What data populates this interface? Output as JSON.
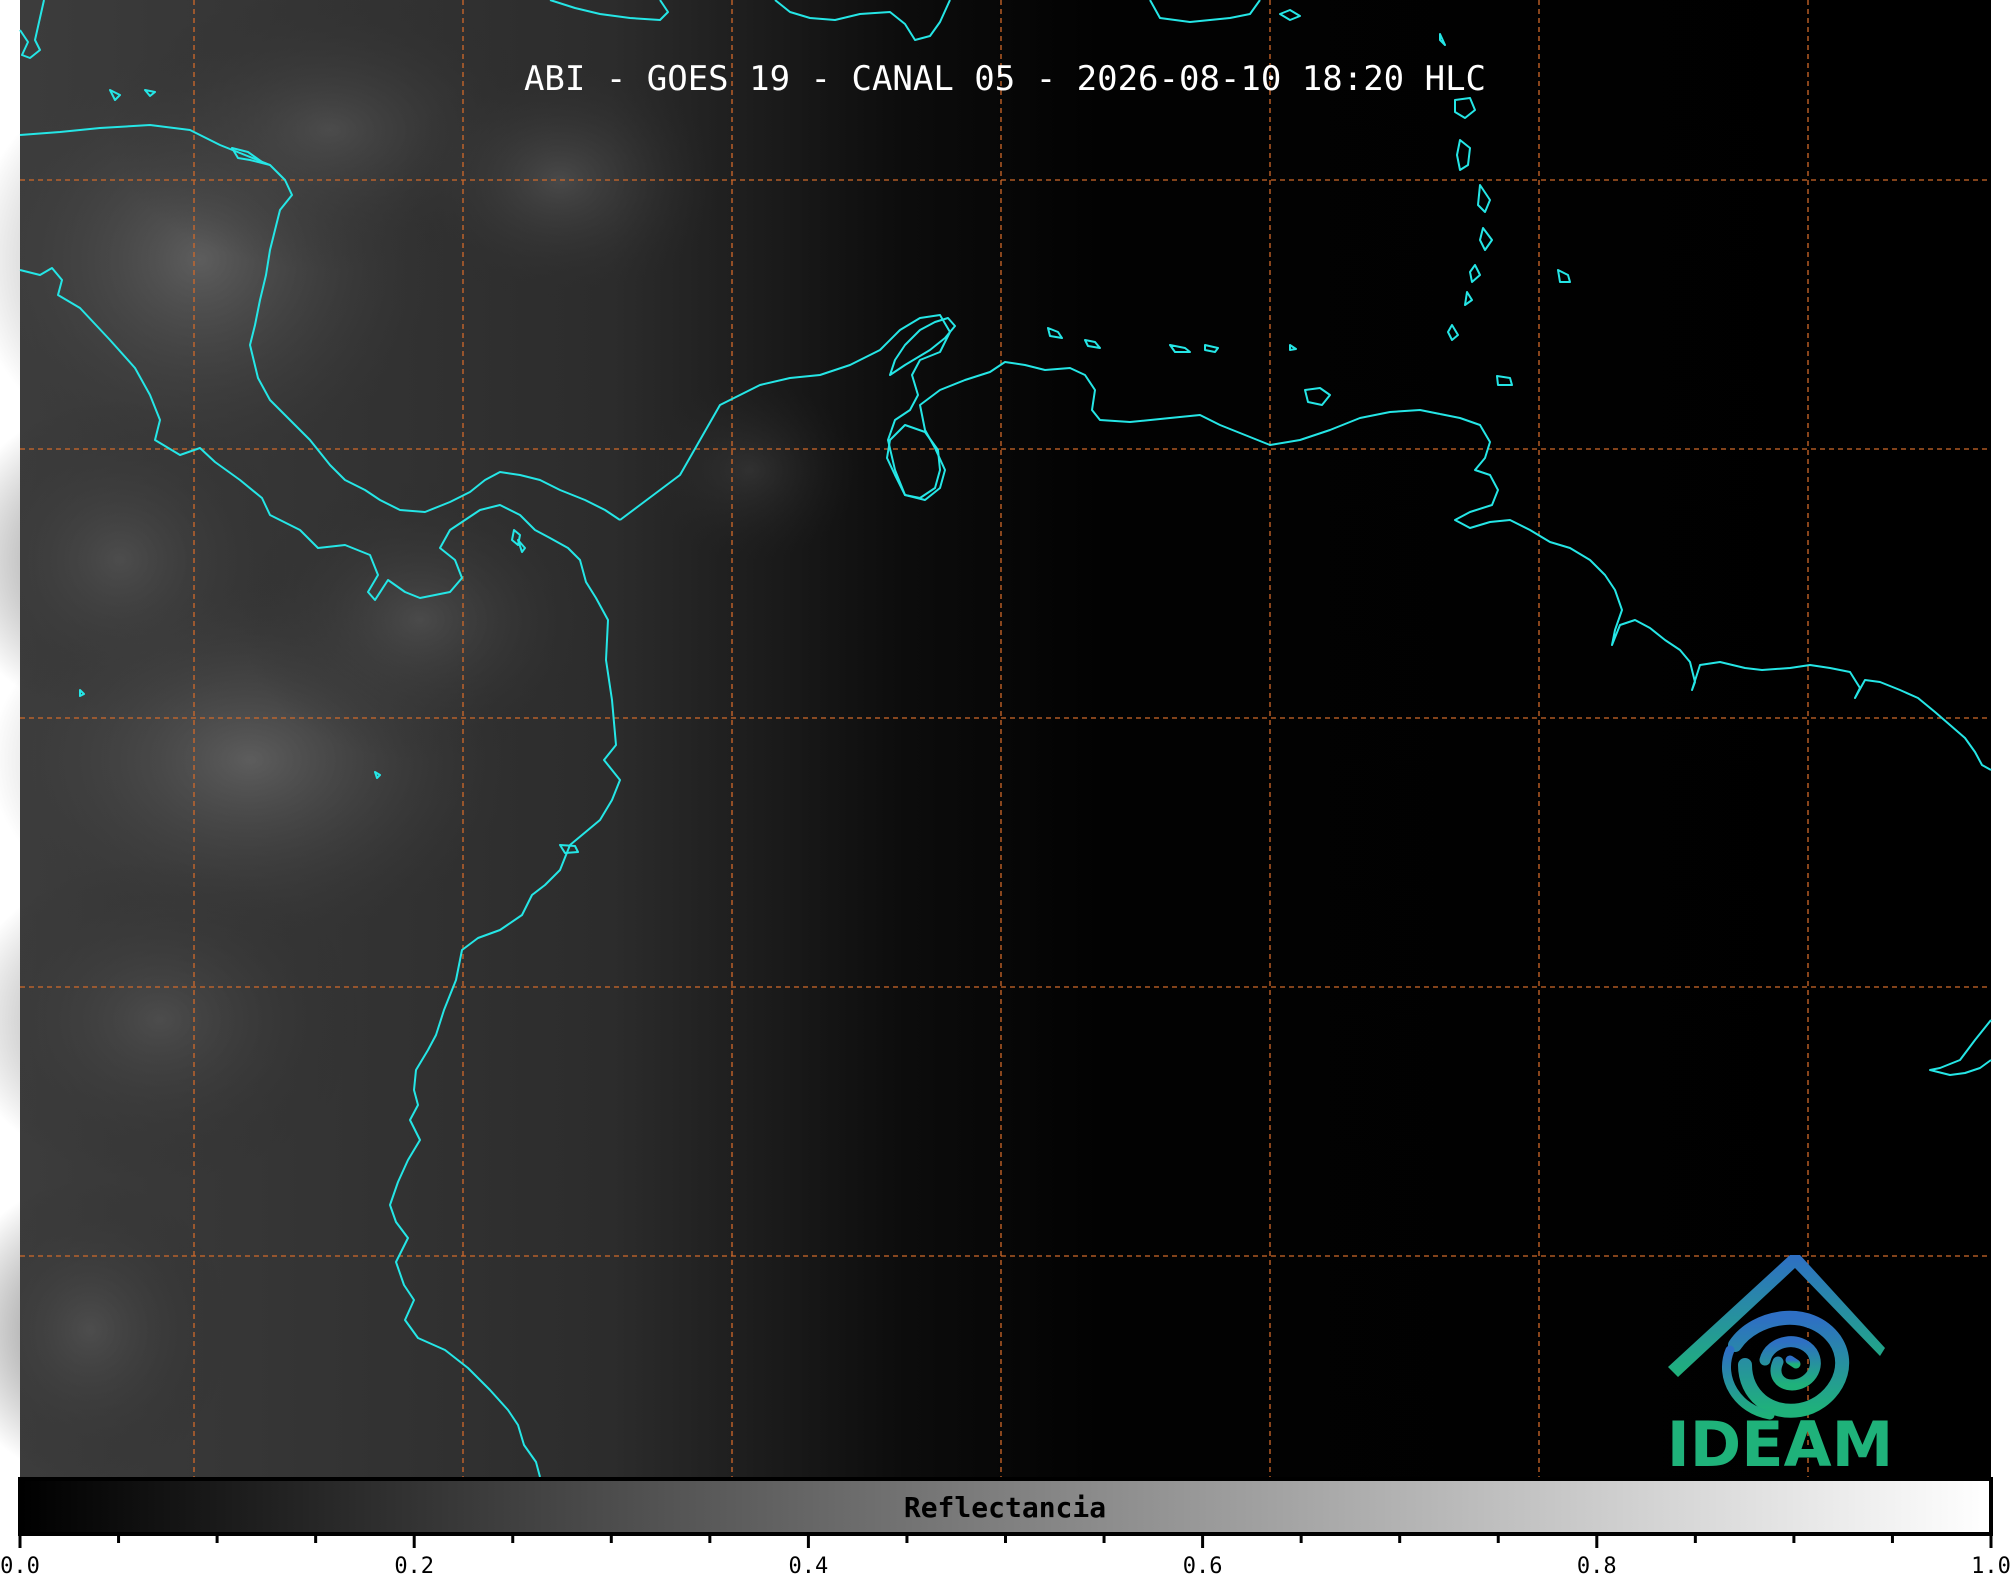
{
  "title": "ABI - GOES 19 - CANAL 05 - 2026-08-10 18:20 HLC",
  "colors": {
    "coastline": "#25e6e6",
    "grid": "#d0692a",
    "background": "#000000",
    "logo_blue": "#2e7fc0",
    "logo_green": "#1fb27a"
  },
  "map": {
    "grid_style": "dashed",
    "grid_lines_vertical": 7,
    "grid_lines_horizontal": 5
  },
  "colorbar": {
    "label": "Reflectancia",
    "range": [
      0.0,
      1.0
    ],
    "gradient": [
      "#000000",
      "#ffffff"
    ],
    "tick_labels": [
      "0.0",
      "0.2",
      "0.4",
      "0.6",
      "0.8",
      "1.0"
    ],
    "minor_tick_step": 0.05
  },
  "logo": {
    "text": "IDEAM"
  }
}
